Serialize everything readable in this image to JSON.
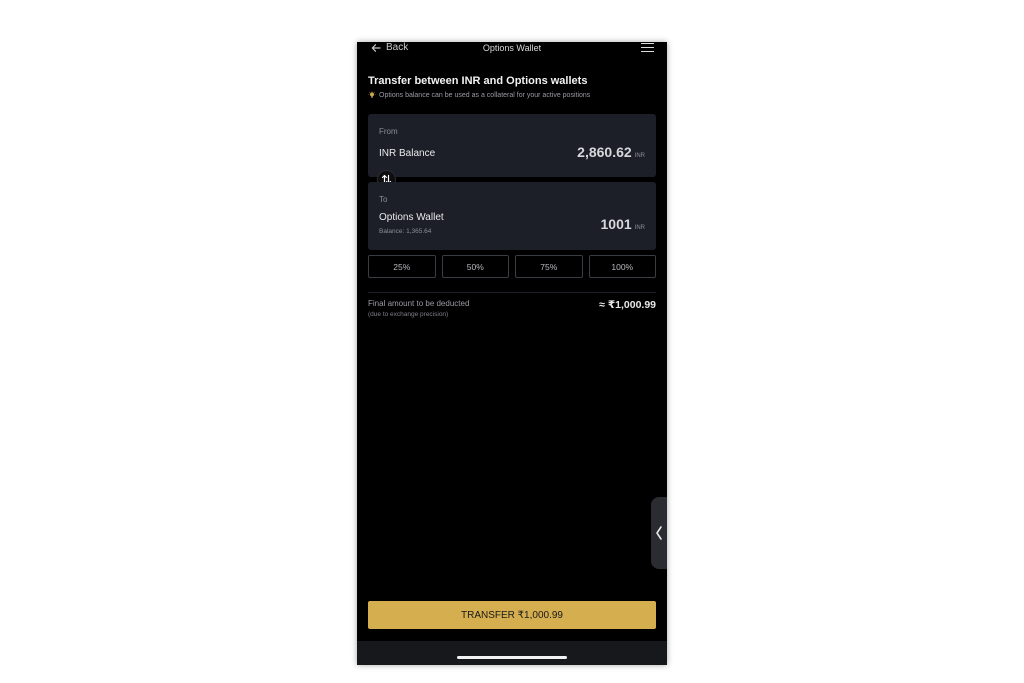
{
  "header": {
    "back_label": "Back",
    "title": "Options Wallet"
  },
  "intro": {
    "heading": "Transfer between INR and Options wallets",
    "hint": "Options balance can be used as a collateral for your active positions"
  },
  "from": {
    "label": "From",
    "name": "INR Balance",
    "amount": "2,860.62",
    "currency": "INR"
  },
  "to": {
    "label": "To",
    "name": "Options Wallet",
    "balance": "Balance: 1,365.64",
    "amount": "1001",
    "currency": "INR"
  },
  "percent_options": [
    "25%",
    "50%",
    "75%",
    "100%"
  ],
  "final": {
    "label": "Final amount to be deducted",
    "sub": "(due to exchange precision)",
    "value": "≈ ₹1,000.99"
  },
  "transfer_button": "TRANSFER ₹1,000.99",
  "colors": {
    "background": "#000000",
    "card": "#1c1f28",
    "accent": "#d4ae4f"
  },
  "icons": {
    "back": "arrow-left-icon",
    "menu": "hamburger-menu-icon",
    "hint": "lightbulb-icon",
    "swap": "swap-vertical-icon",
    "side_handle": "chevron-left-icon"
  }
}
